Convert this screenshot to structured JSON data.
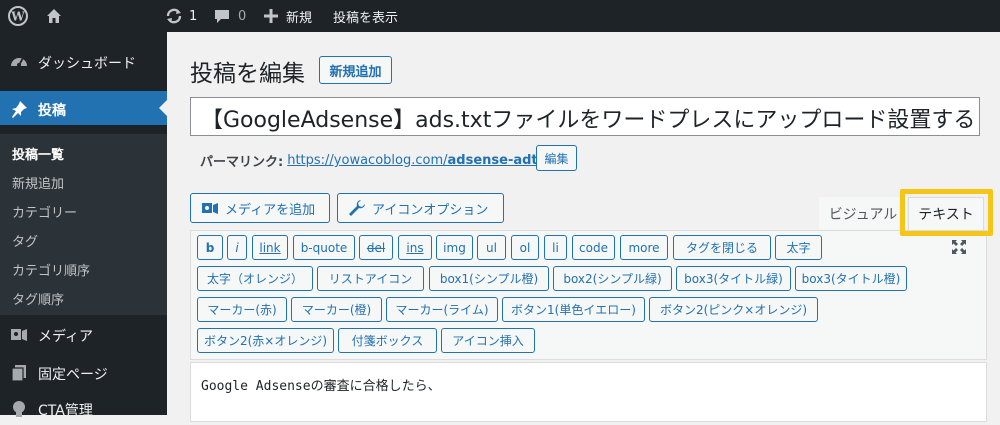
{
  "adminbar": {
    "updates_count": "1",
    "comments_count": "0",
    "new_label": "新規",
    "view_post_label": "投稿を表示"
  },
  "sidebar": {
    "items": [
      {
        "label": "ダッシュボード",
        "icon": "dashboard-icon"
      },
      {
        "label": "投稿",
        "icon": "pin-icon"
      },
      {
        "label": "メディア",
        "icon": "media-icon"
      },
      {
        "label": "固定ページ",
        "icon": "page-icon"
      },
      {
        "label": "CTA管理",
        "icon": "lightbulb-icon"
      }
    ],
    "submenu": [
      "投稿一覧",
      "新規追加",
      "カテゴリー",
      "タグ",
      "カテゴリ順序",
      "タグ順序"
    ]
  },
  "main": {
    "heading": "投稿を編集",
    "add_new": "新規追加",
    "title_value": "【GoogleAdsense】ads.txtファイルをワードプレスにアップロード設置する",
    "permalink_label": "パーマリンク:",
    "permalink_base": "https://yowacoblog.com/",
    "permalink_slug": "adsense-adtxt",
    "permalink_tail": "/",
    "edit_button": "編集",
    "add_media": "メディアを追加",
    "icon_options": "アイコンオプション",
    "tab_visual": "ビジュアル",
    "tab_text": "テキスト",
    "quicktags": [
      "b",
      "i",
      "link",
      "b-quote",
      "del",
      "ins",
      "img",
      "ul",
      "ol",
      "li",
      "code",
      "more",
      "タグを閉じる",
      "太字",
      "太字（オレンジ）",
      "リストアイコン",
      "box1(シンプル橙)",
      "box2(シンプル緑)",
      "box3(タイトル緑)",
      "box3(タイトル橙)",
      "マーカー(赤)",
      "マーカー(橙)",
      "マーカー(ライム)",
      "ボタン1(単色イエロー)",
      "ボタン2(ピンク×オレンジ)",
      "ボタン2(赤×オレンジ)",
      "付箋ボックス",
      "アイコン挿入"
    ],
    "editor_text": "Google Adsenseの審査に合格したら、"
  },
  "colors": {
    "admin_dark": "#1d2327",
    "wp_blue": "#2271b1",
    "highlight": "#f5c518"
  }
}
